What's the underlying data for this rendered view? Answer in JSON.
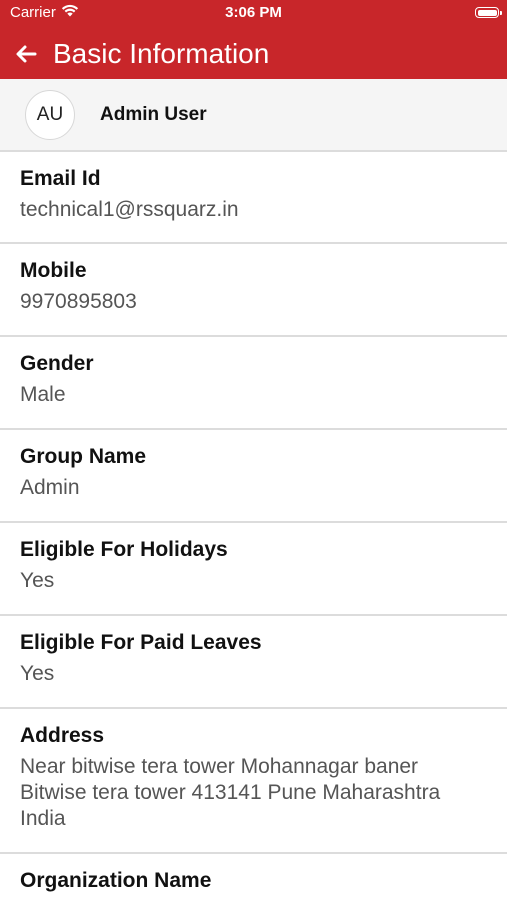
{
  "status_bar": {
    "carrier": "Carrier",
    "time": "3:06 PM"
  },
  "header": {
    "title": "Basic Information",
    "background_color": "#c8262a"
  },
  "user": {
    "initials": "AU",
    "name": "Admin User"
  },
  "fields": [
    {
      "label": "Email Id",
      "value": "technical1@rssquarz.in"
    },
    {
      "label": "Mobile",
      "value": "9970895803"
    },
    {
      "label": "Gender",
      "value": "Male"
    },
    {
      "label": "Group Name",
      "value": "Admin"
    },
    {
      "label": "Eligible For Holidays",
      "value": "Yes"
    },
    {
      "label": "Eligible For Paid Leaves",
      "value": "Yes"
    },
    {
      "label": "Address",
      "value": "Near bitwise tera tower Mohannagar baner Bitwise tera tower 413141 Pune Maharashtra India"
    },
    {
      "label": "Organization Name",
      "value": ""
    }
  ]
}
